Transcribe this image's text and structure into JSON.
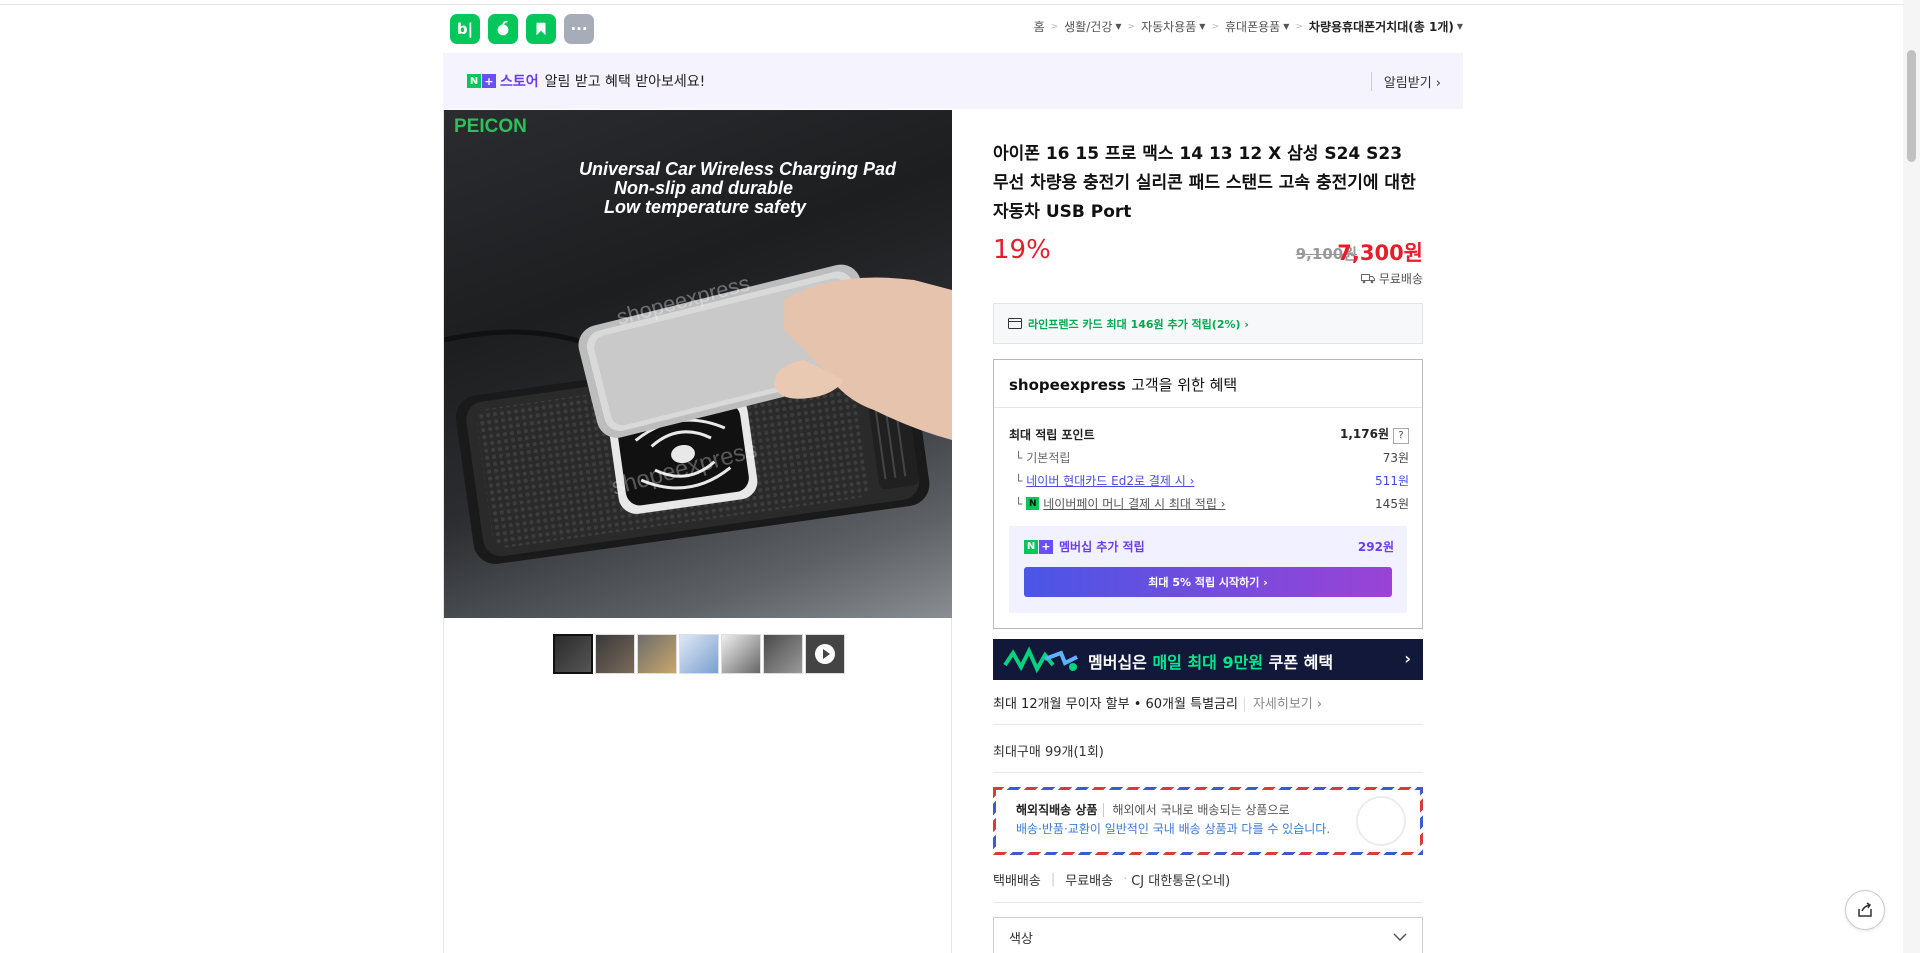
{
  "header": {
    "apps": [
      {
        "name": "blog-icon",
        "label": "b|"
      },
      {
        "name": "apple-icon",
        "label": ""
      },
      {
        "name": "bookmark-icon",
        "label": ""
      },
      {
        "name": "more-icon",
        "label": "···"
      }
    ],
    "breadcrumb": [
      {
        "label": "홈",
        "dropdown": false
      },
      {
        "label": "생활/건강",
        "dropdown": true
      },
      {
        "label": "자동차용품",
        "dropdown": true
      },
      {
        "label": "휴대폰용품",
        "dropdown": true
      },
      {
        "label": "차량용휴대폰거치대(총 1개)",
        "dropdown": true
      }
    ]
  },
  "notice": {
    "store": "스토어",
    "message": "알림 받고 혜택 받아보세요!",
    "action": "알림받기 ›"
  },
  "gallery": {
    "brand": "PEICON",
    "lines": [
      "Universal Car Wireless Charging Pad",
      "Non-slip and durable",
      "Low temperature safety"
    ],
    "watermark": "shopeexpress",
    "thumb_count": 7
  },
  "product": {
    "title": "아이폰 16 15 프로 맥스 14 13 12 X 삼성 S24 S23 무선 차량용 충전기 실리콘 패드 스탠드 고속 충전기에 대한 자동차 USB Port",
    "discount": "19%",
    "original_price": "9,100원",
    "price": "7,300원",
    "shipping": "무료배송",
    "card_benefit": "라인프렌즈 카드 최대 146원 추가 적립(2%) ›"
  },
  "benefit": {
    "store": "shopeexpress",
    "title_suffix": "고객을 위한 혜택",
    "max_points_label": "최대 적립 포인트",
    "max_points_value": "1,176원",
    "qmark": "?",
    "rows": [
      {
        "label": "기본적립",
        "value": "73원"
      },
      {
        "label": "네이버 현대카드 Ed2로 결제 시 ›",
        "value": "511원"
      },
      {
        "label": "네이버페이 머니 결제 시 최대 적립 ›",
        "value": "145원"
      }
    ],
    "membership_label": "멤버십 추가 적립",
    "membership_value": "292원",
    "membership_button": "최대 5% 적립 시작하기 ›"
  },
  "promo": {
    "prefix": "멤버십은 ",
    "highlight": "매일 최대 9만원",
    "suffix": " 쿠폰 혜택",
    "chevron": "›"
  },
  "installment": {
    "text": "최대 12개월 무이자 할부 • 60개월 특별금리",
    "more": "자세히보기 ›"
  },
  "max_purchase": "최대구매 99개(1회)",
  "overseas": {
    "title": "해외직배송 상품",
    "desc": "해외에서 국내로 배송되는 상품으로",
    "note": "배송·반품·교환이 일반적인 국내 배송 상품과 다를 수 있습니다."
  },
  "delivery": {
    "type": "택배배송",
    "fee": "무료배송",
    "carrier": "CJ 대한통운(오네)"
  },
  "option": {
    "label": "색상"
  },
  "colors": {
    "naver_green": "#03c75a",
    "price_red": "#e61e2b",
    "membership_purple": "#6b3df0"
  }
}
